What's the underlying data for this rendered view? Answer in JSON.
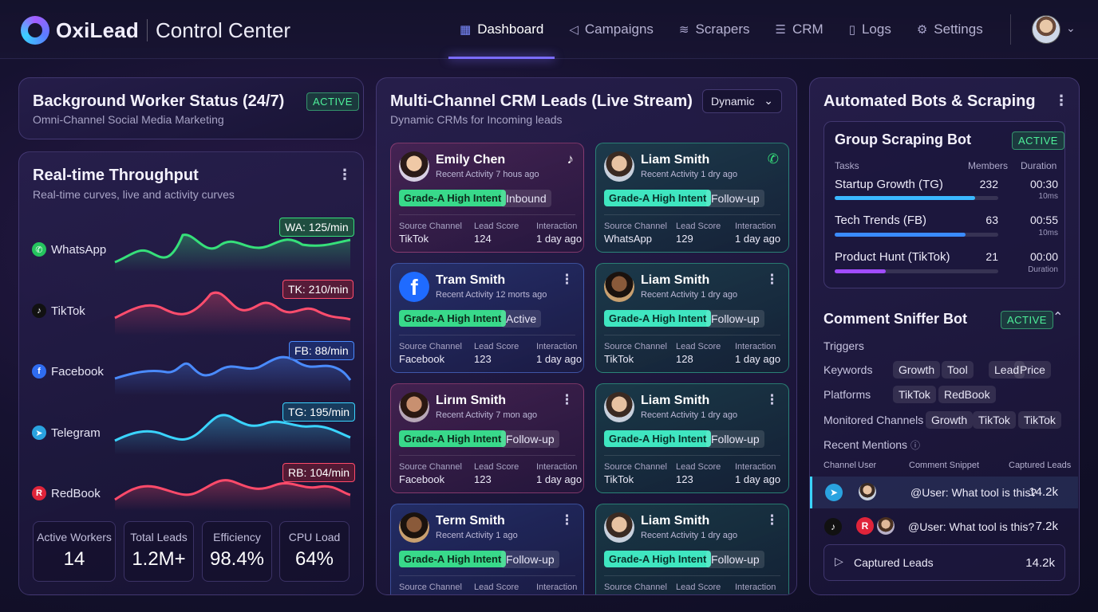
{
  "app": {
    "name": "OxiLead",
    "subtitle": "Control Center"
  },
  "nav": [
    {
      "label": "Dashboard",
      "icon": "grid-icon",
      "active": true
    },
    {
      "label": "Campaigns",
      "icon": "megaphone-icon"
    },
    {
      "label": "Scrapers",
      "icon": "layers-icon"
    },
    {
      "label": "CRM",
      "icon": "database-icon"
    },
    {
      "label": "Logs",
      "icon": "document-icon"
    },
    {
      "label": "Settings",
      "icon": "gear-icon"
    }
  ],
  "worker": {
    "title": "Background Worker Status (24/7)",
    "subtitle": "Omni-Channel Social Media Marketing",
    "status": "ACTIVE"
  },
  "throughput": {
    "title": "Real-time Throughput",
    "subtitle": "Real-time curves, live and activity curves",
    "channels": [
      {
        "name": "WhatsApp",
        "rate": "WA: 125/min",
        "color": "#36e07a"
      },
      {
        "name": "TikTok",
        "rate": "TK: 210/min",
        "color": "#ff4d6d"
      },
      {
        "name": "Facebook",
        "rate": "FB: 88/min",
        "color": "#4a8bff"
      },
      {
        "name": "Telegram",
        "rate": "TG: 195/min",
        "color": "#3ad4ff"
      },
      {
        "name": "RedBook",
        "rate": "RB: 104/min",
        "color": "#ff4a6a"
      }
    ],
    "stats": [
      {
        "label": "Active Workers",
        "value": "14"
      },
      {
        "label": "Total Leads",
        "value": "1.2M+"
      },
      {
        "label": "Efficiency",
        "value": "98.4%"
      },
      {
        "label": "CPU Load",
        "value": "64%"
      }
    ]
  },
  "crm": {
    "title": "Multi-Channel CRM Leads (Live Stream)",
    "subtitle": "Dynamic CRMs for Incoming leads",
    "dropdown": "Dynamic",
    "field_labels": {
      "source": "Source Channel",
      "score": "Lead Score",
      "interaction": "Interaction"
    },
    "cards": [
      {
        "name": "Emily Chen",
        "recent": "Recent Activity 7 hous ago",
        "grade": "Grade-A High Intent",
        "status": "Inbound",
        "source": "TikTok",
        "score": "124",
        "interaction": "1 day ago"
      },
      {
        "name": "Liam Smith",
        "recent": "Recent Activity 1 dry ago",
        "grade": "Grade-A High Intent",
        "status": "Follow-up",
        "source": "WhatsApp",
        "score": "129",
        "interaction": "1 day ago"
      },
      {
        "name": "Tram Smith",
        "recent": "Recent Activity 12 morts ago",
        "grade": "Grade-A High Intent",
        "status": "Active",
        "source": "Facebook",
        "score": "123",
        "interaction": "1 day ago"
      },
      {
        "name": "Liam Smith",
        "recent": "Recent Activity 1 dry ago",
        "grade": "Grade-A High Intent",
        "status": "Follow-up",
        "source": "TikTok",
        "score": "128",
        "interaction": "1 day ago"
      },
      {
        "name": "Lirım Smith",
        "recent": "Recent Activity 7 mon ago",
        "grade": "Grade-A High Intent",
        "status": "Follow-up",
        "source": "Facebook",
        "score": "123",
        "interaction": "1 day ago"
      },
      {
        "name": "Liam Smith",
        "recent": "Recent Activity 1 dry ago",
        "grade": "Grade-A High Intent",
        "status": "Follow-up",
        "source": "TikTok",
        "score": "123",
        "interaction": "1 day ago"
      },
      {
        "name": "Term Smith",
        "recent": "Recent Activity 1 ago",
        "grade": "Grade-A High Intent",
        "status": "Follow-up"
      },
      {
        "name": "Liam Smith",
        "recent": "Recent Activity 1 dry ago",
        "grade": "Grade-A High Intent",
        "status": "Follow-up"
      }
    ]
  },
  "bots": {
    "title": "Automated Bots & Scraping",
    "group": {
      "title": "Group Scraping Bot",
      "status": "ACTIVE",
      "headers": {
        "tasks": "Tasks",
        "members": "Members",
        "duration": "Duration"
      },
      "tasks": [
        {
          "name": "Startup Growth (TG)",
          "members": "232",
          "duration": "00:30",
          "sub": "10ms",
          "progress": 0.86,
          "color": "#3ab8ff"
        },
        {
          "name": "Tech Trends (FB)",
          "members": "63",
          "duration": "00:55",
          "sub": "10ms",
          "progress": 0.8,
          "color": "#3a8bff"
        },
        {
          "name": "Product Hunt (TikTok)",
          "members": "21",
          "duration": "00:00",
          "sub": "Duration",
          "progress": 0.31,
          "color": "#a04cff"
        }
      ]
    },
    "sniffer": {
      "title": "Comment Sniffer Bot",
      "status": "ACTIVE",
      "triggers": "Triggers",
      "keywords_label": "Keywords",
      "keywords": [
        "Growth",
        "Tool",
        "Lead",
        "Price"
      ],
      "platforms_label": "Platforms",
      "platforms": [
        "TikTok",
        "RedBook"
      ],
      "channels_label": "Monitored Channels",
      "channels": [
        "Growth",
        "TikTok",
        "TikTok"
      ],
      "recent_label": "Recent Mentions",
      "mention_headers": {
        "channel": "Channel",
        "user": "User",
        "snippet": "Comment Snippet",
        "captured": "Captured Leads"
      },
      "mentions": [
        {
          "snippet": "@User: What tool is this?",
          "count": "14.2k"
        },
        {
          "snippet": "@User: What tool is this?",
          "count": "7.2k"
        }
      ],
      "captured": {
        "label": "Captured Leads",
        "value": "14.2k"
      }
    }
  }
}
